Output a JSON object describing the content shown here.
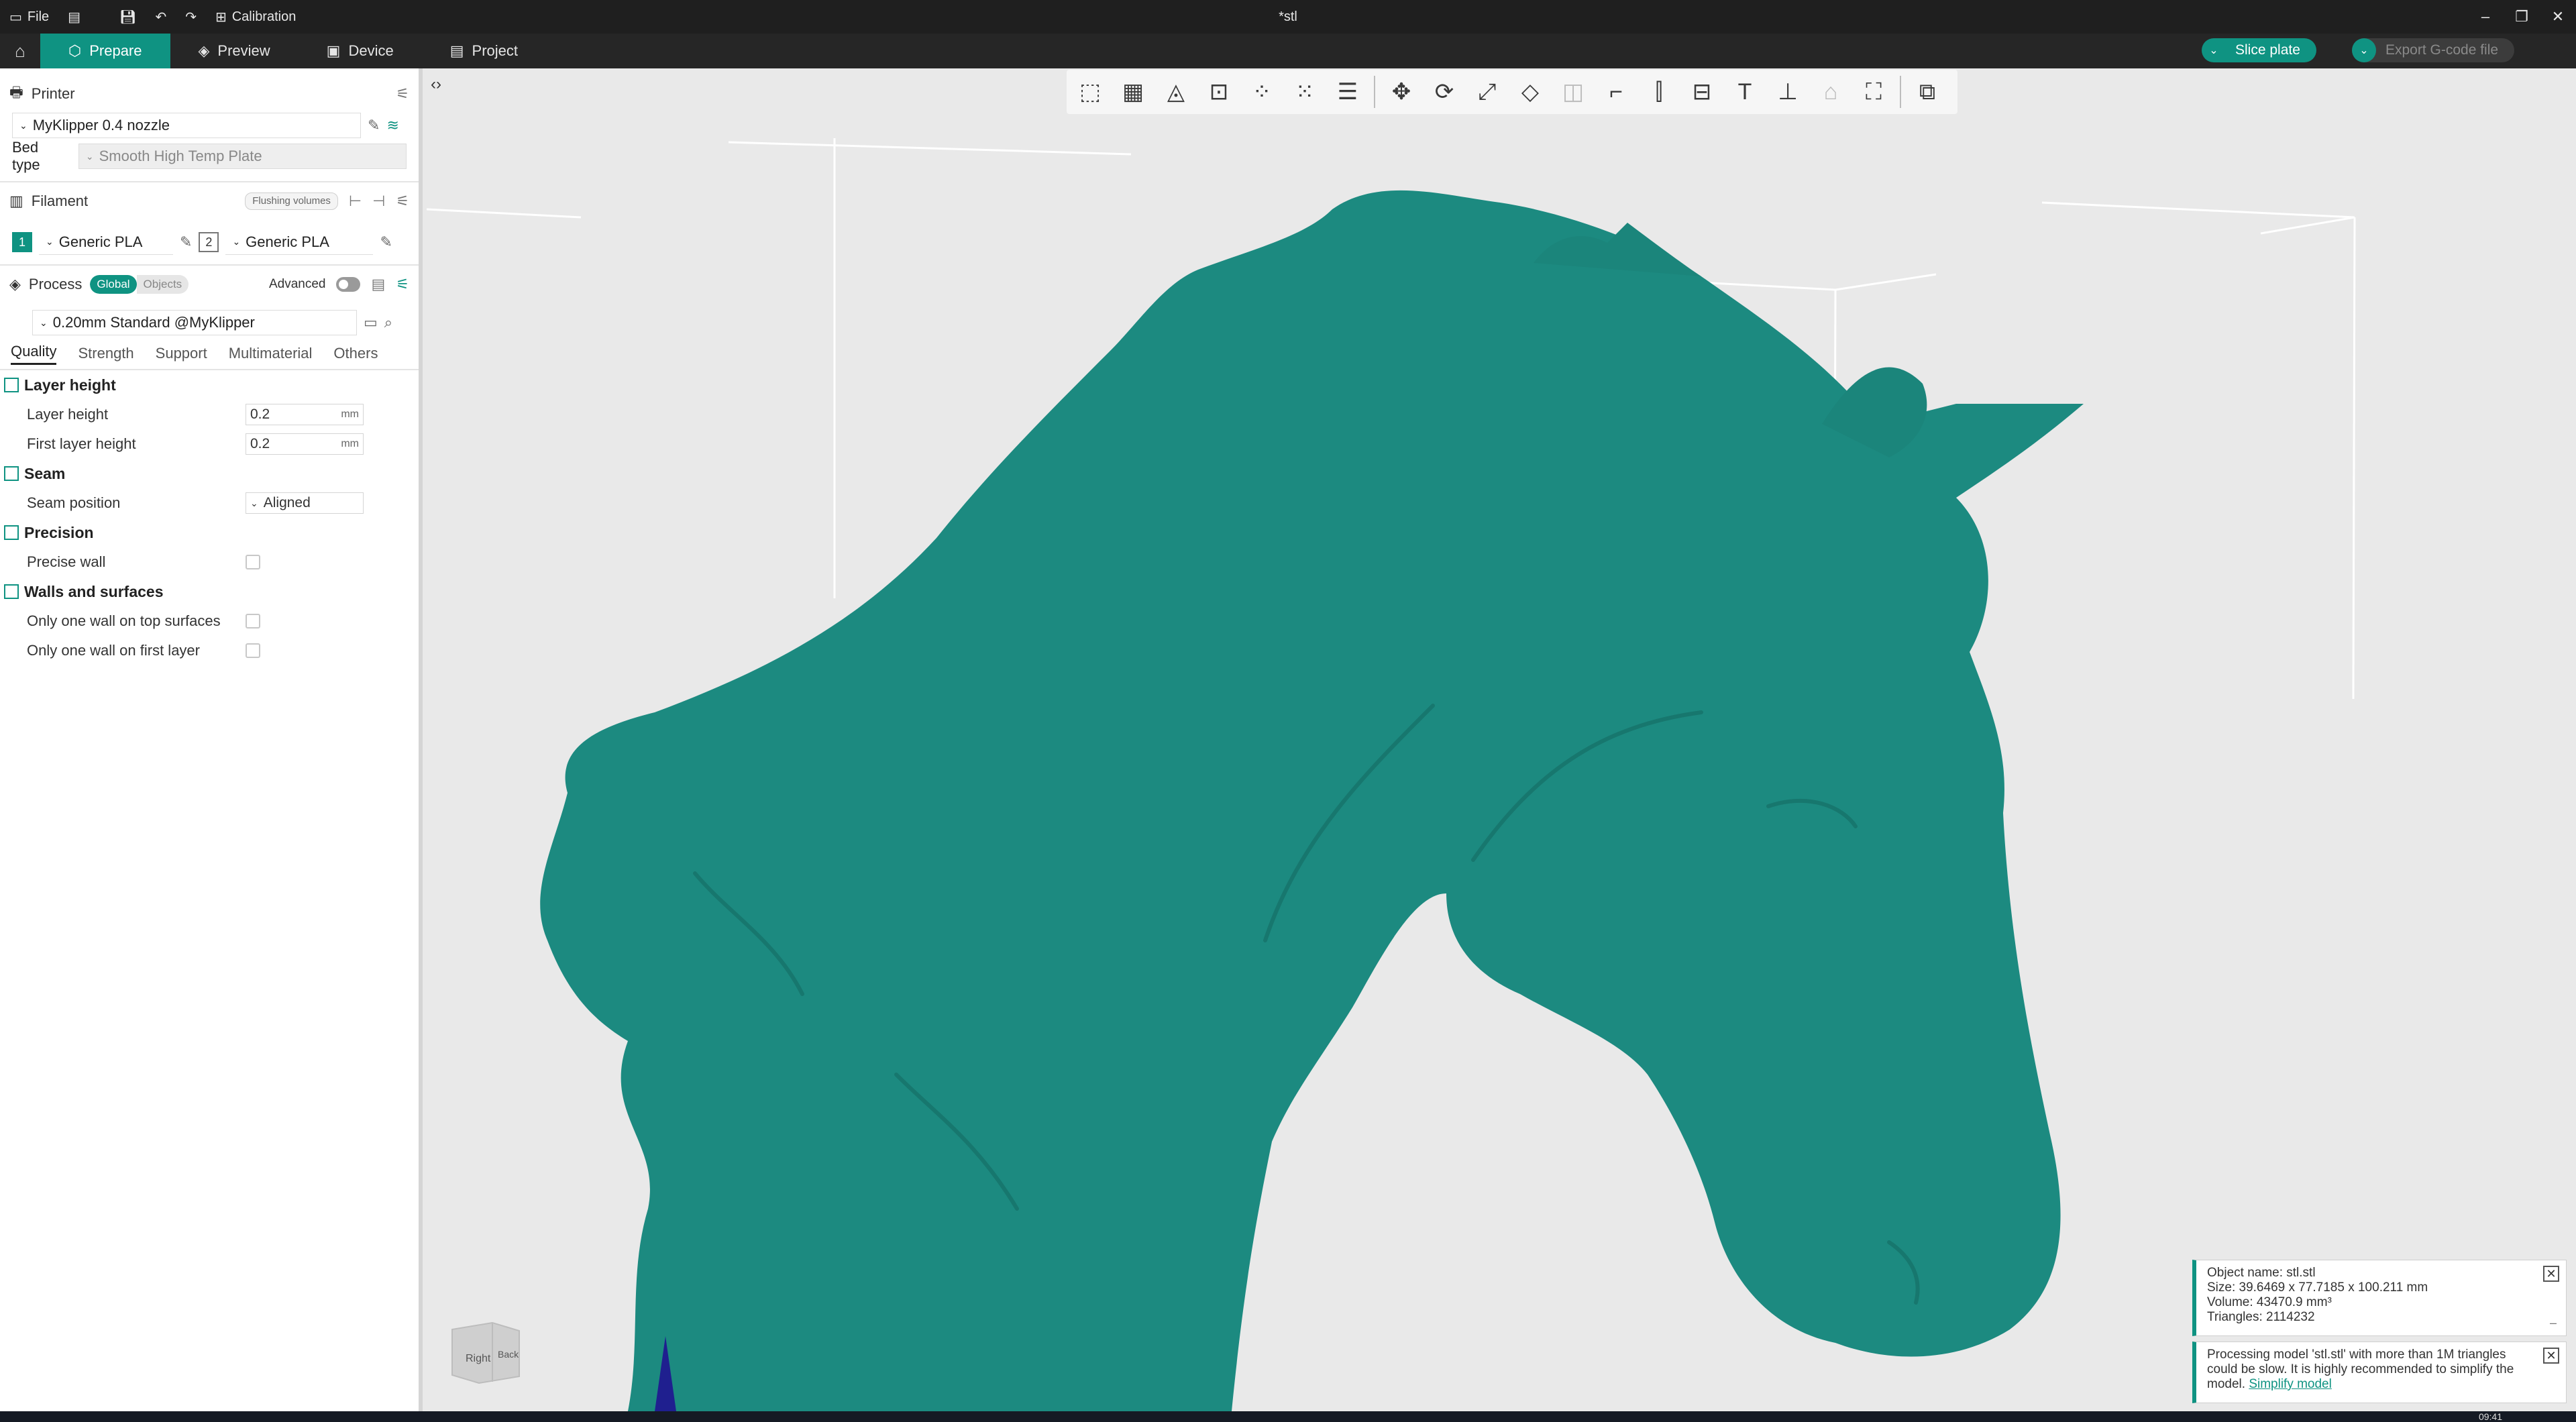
{
  "titlebar": {
    "file_label": "File",
    "calibration_label": "Calibration",
    "window_title": "*stl",
    "minimize": "–",
    "restore": "❐",
    "close": "✕"
  },
  "tabs": [
    {
      "label": "Prepare",
      "icon": "cube-icon",
      "active": true
    },
    {
      "label": "Preview",
      "icon": "layers-icon",
      "active": false
    },
    {
      "label": "Device",
      "icon": "device-icon",
      "active": false
    },
    {
      "label": "Project",
      "icon": "project-icon",
      "active": false
    }
  ],
  "actions": {
    "slice_label": "Slice plate",
    "export_label": "Export G-code file"
  },
  "printer": {
    "section_title": "Printer",
    "name": "MyKlipper 0.4 nozzle",
    "bed_type_label": "Bed type",
    "bed_type_value": "Smooth High Temp Plate"
  },
  "filament": {
    "section_title": "Filament",
    "flushing_label": "Flushing volumes",
    "slots": [
      {
        "index": "1",
        "name": "Generic PLA"
      },
      {
        "index": "2",
        "name": "Generic PLA"
      }
    ]
  },
  "process": {
    "section_title": "Process",
    "global_label": "Global",
    "objects_label": "Objects",
    "advanced_label": "Advanced",
    "advanced_on": false,
    "preset": "0.20mm Standard @MyKlipper",
    "tabs": [
      "Quality",
      "Strength",
      "Support",
      "Multimaterial",
      "Others"
    ],
    "active_tab": "Quality"
  },
  "quality": {
    "layer_height_group": "Layer height",
    "layer_height_label": "Layer height",
    "layer_height_value": "0.2",
    "first_layer_height_label": "First layer height",
    "first_layer_height_value": "0.2",
    "unit": "mm",
    "seam_group": "Seam",
    "seam_position_label": "Seam position",
    "seam_position_value": "Aligned",
    "precision_group": "Precision",
    "precise_wall_label": "Precise wall",
    "precise_wall_checked": false,
    "walls_group": "Walls and surfaces",
    "one_wall_top_label": "Only one wall on top surfaces",
    "one_wall_top_checked": false,
    "one_wall_first_label": "Only one wall on first layer",
    "one_wall_first_checked": false
  },
  "notifications": {
    "object_info": {
      "name": "Object name: stl.stl",
      "size": "Size: 39.6469 x 77.7185 x 100.211 mm",
      "volume": "Volume: 43470.9 mm³",
      "triangles": "Triangles: 2114232"
    },
    "warning": {
      "text": "Processing model 'stl.stl' with more than 1M triangles could be slow. It is highly recommended to simplify the model.",
      "link": "Simplify model"
    }
  },
  "navcube": {
    "right_label": "Right",
    "back_label": "Back"
  },
  "taskbar": {
    "time": "09:41"
  },
  "colors": {
    "accent": "#0f9382",
    "model": "#1c8a80",
    "background": "#e9e9e9",
    "titlebar": "#1f1f1f"
  }
}
